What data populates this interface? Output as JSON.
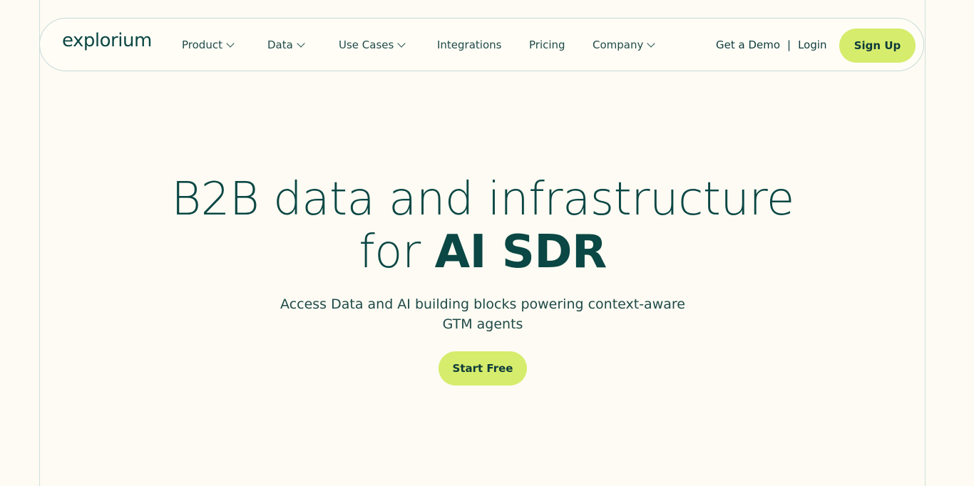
{
  "nav": {
    "logo": "explorium",
    "items": [
      {
        "label": "Product"
      },
      {
        "label": "Data"
      },
      {
        "label": "Use Cases"
      },
      {
        "label": "Integrations"
      },
      {
        "label": "Pricing"
      },
      {
        "label": "Company"
      }
    ],
    "get_demo": "Get a Demo",
    "separator": "|",
    "login": "Login",
    "signup": "Sign Up"
  },
  "hero": {
    "title_line1": "B2B data and infrastructure",
    "title_line2_prefix": "for ",
    "title_line2_bold": "AI SDR",
    "subtitle_line1": "Access Data and AI building blocks powering context-aware",
    "subtitle_line2": "GTM agents",
    "cta": "Start Free"
  },
  "colors": {
    "background": "#fdfbf3",
    "accent": "#d6ec6c",
    "text": "#0b4744"
  }
}
